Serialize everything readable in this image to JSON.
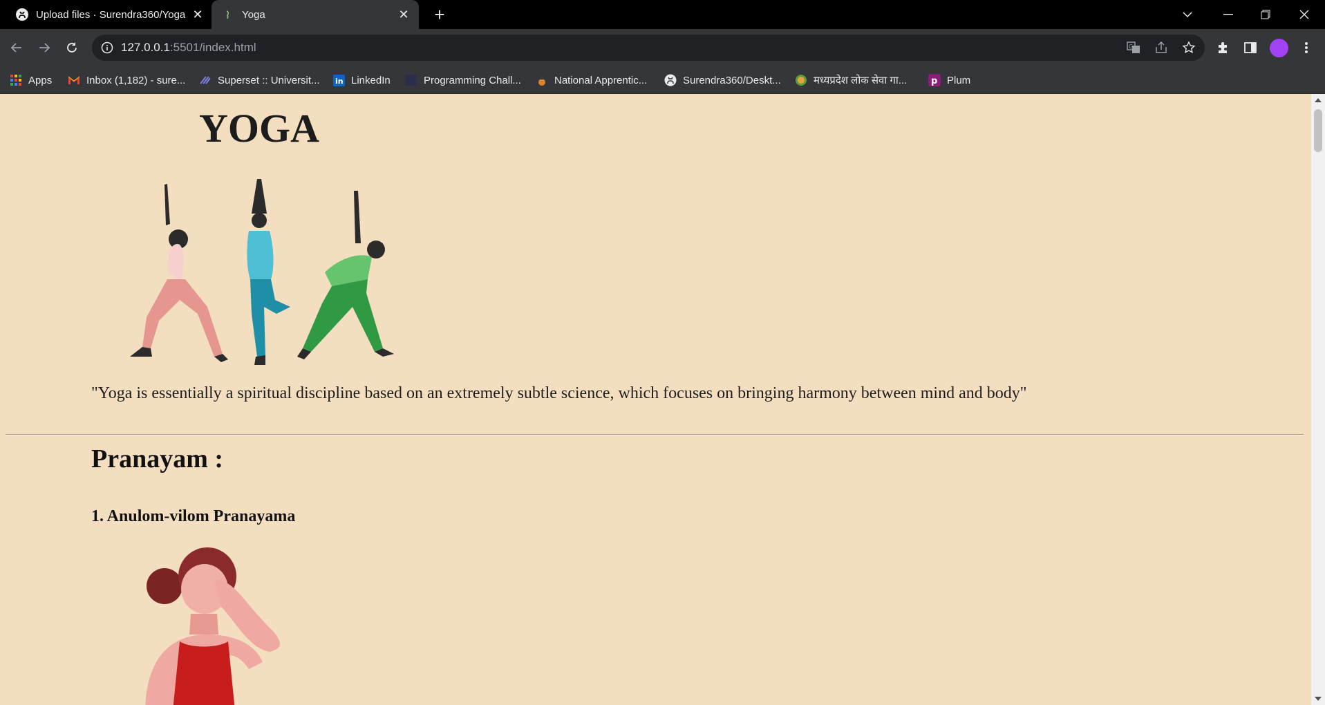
{
  "browser": {
    "tabs": [
      {
        "title": "Upload files · Surendra360/Yoga",
        "active": false
      },
      {
        "title": "Yoga",
        "active": true
      }
    ],
    "address_bar": {
      "host": "127.0.0.1",
      "rest": ":5501/index.html"
    },
    "bookmarks": [
      {
        "label": "Apps",
        "icon": "apps-grid-icon"
      },
      {
        "label": "Inbox (1,182) - sure...",
        "icon": "gmail-icon"
      },
      {
        "label": "Superset :: Universit...",
        "icon": "superset-icon"
      },
      {
        "label": "LinkedIn",
        "icon": "linkedin-icon"
      },
      {
        "label": "Programming Chall...",
        "icon": "page-icon"
      },
      {
        "label": "National Apprentic...",
        "icon": "emblem-icon"
      },
      {
        "label": "Surendra360/Deskt...",
        "icon": "github-icon"
      },
      {
        "label": "मध्यप्रदेश लोक सेवा गा...",
        "icon": "mp-seal-icon"
      },
      {
        "label": "Plum",
        "icon": "plum-icon"
      }
    ]
  },
  "page": {
    "title": "YOGA",
    "quote": "\"Yoga is essentially a spiritual discipline based on an extremely subtle science, which focuses on bringing harmony between mind and body\"",
    "section": {
      "title": "Pranayam :",
      "items": [
        {
          "title": "1. Anulom-vilom Pranayama"
        }
      ]
    }
  },
  "colors": {
    "page_background": "#f4dec0",
    "tab_strip": "#000000",
    "toolbar": "#35363a"
  }
}
